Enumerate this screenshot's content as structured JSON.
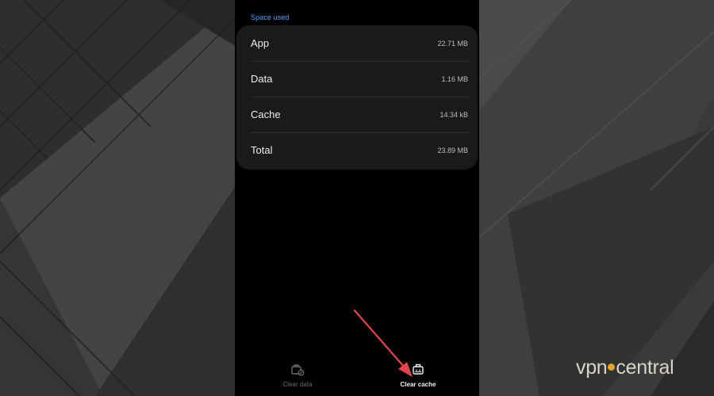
{
  "storage": {
    "section_title": "Space used",
    "rows": [
      {
        "label": "App",
        "value": "22.71 MB"
      },
      {
        "label": "Data",
        "value": "1.16 MB"
      },
      {
        "label": "Cache",
        "value": "14.34 kB"
      },
      {
        "label": "Total",
        "value": "23.89 MB"
      }
    ]
  },
  "actions": {
    "clear_data": {
      "label": "Clear data",
      "icon": "clear-data-icon",
      "enabled": false
    },
    "clear_cache": {
      "label": "Clear cache",
      "icon": "clear-cache-icon",
      "enabled": true
    }
  },
  "annotation": {
    "arrow_color": "#e0474c",
    "points_to": "clear-cache-button"
  },
  "watermark": {
    "brand_left": "vpn",
    "brand_right": "central",
    "dot_color": "#e7a52b"
  },
  "colors": {
    "accent": "#4aa3ff",
    "screen_bg": "#000000",
    "card_bg": "#1a1a1a"
  }
}
